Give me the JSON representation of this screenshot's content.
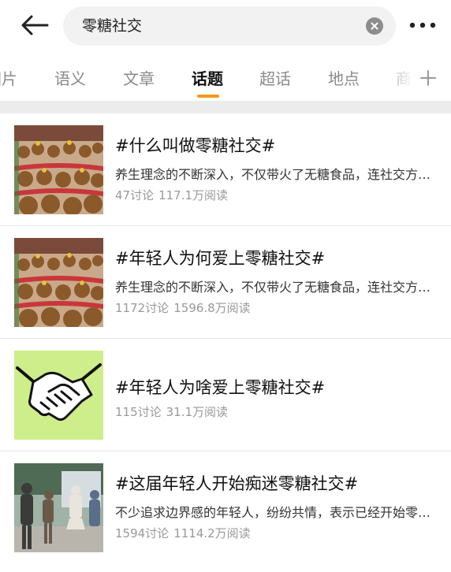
{
  "search": {
    "query": "零糖社交"
  },
  "tabs": [
    {
      "label": "图片"
    },
    {
      "label": "语义"
    },
    {
      "label": "文章"
    },
    {
      "label": "话题",
      "active": true
    },
    {
      "label": "超话"
    },
    {
      "label": "地点"
    },
    {
      "label": "商"
    }
  ],
  "topics": [
    {
      "title": "#什么叫做零糖社交#",
      "desc": "养生理念的不断深入，不仅带火了无糖食品，连社交方式也开始讲究“零糖”了",
      "discussions": "47讨论",
      "reads": "117.1万阅读",
      "thumb": "plush-toys-image"
    },
    {
      "title": "#年轻人为何爱上零糖社交#",
      "desc": "养生理念的不断深入，不仅带火了无糖食品，连社交方式也开始讲究“零糖”了",
      "discussions": "1172讨论",
      "reads": "1596.8万阅读",
      "thumb": "plush-toys-image"
    },
    {
      "title": "#年轻人为啥爱上零糖社交#",
      "desc": "",
      "discussions": "115讨论",
      "reads": "31.1万阅读",
      "thumb": "handshake-image"
    },
    {
      "title": "#这届年轻人开始痴迷零糖社交#",
      "desc": "不少追求边界感的年轻人，纷纷共情，表示已经开始零糖社交了",
      "discussions": "1594讨论",
      "reads": "1114.2万阅读",
      "thumb": "people-street-photo"
    }
  ],
  "colors": {
    "accent": "#f39a1c",
    "handshake_bg": "#cdee8a"
  }
}
